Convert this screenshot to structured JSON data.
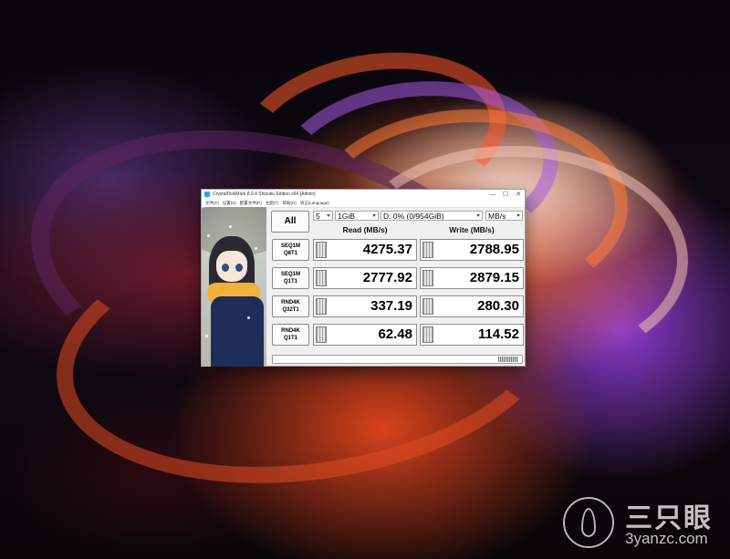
{
  "watermark": {
    "name": "三只眼",
    "domain": "3yanzc.com"
  },
  "window": {
    "title": "CrystalDiskMark 8.0.4 Shizuku Edition x64 [Admin]",
    "controls": [
      "—",
      "☐",
      "✕"
    ],
    "menu": [
      "文件(F)",
      "设置(S)",
      "配置文件(P)",
      "主题(T)",
      "帮助(H)",
      "语言(Language)"
    ]
  },
  "toolbar": {
    "all_label": "All",
    "count": "5",
    "size": "1GiB",
    "drive": "D: 0% (0/954GiB)",
    "unit": "MB/s"
  },
  "headers": {
    "read": "Read (MB/s)",
    "write": "Write (MB/s)"
  },
  "tests": [
    {
      "line1": "SEQ1M",
      "line2": "Q8T1",
      "read": "4275.37",
      "write": "2788.95"
    },
    {
      "line1": "SEQ1M",
      "line2": "Q1T1",
      "read": "2777.92",
      "write": "2879.15"
    },
    {
      "line1": "RND4K",
      "line2": "Q32T1",
      "read": "337.19",
      "write": "280.30"
    },
    {
      "line1": "RND4K",
      "line2": "Q1T1",
      "read": "62.48",
      "write": "114.52"
    }
  ],
  "colors": {
    "window_bg": "#f0f0f0",
    "result_bg": "#ffffff"
  }
}
